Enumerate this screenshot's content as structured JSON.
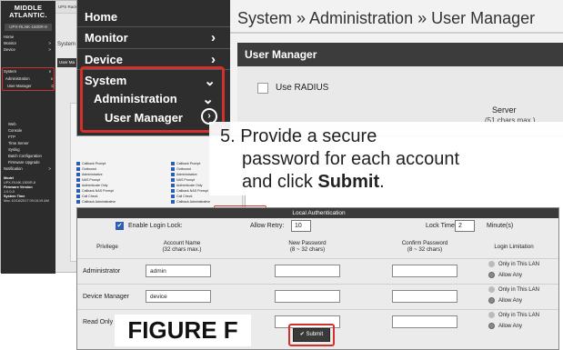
{
  "background": {
    "brand": "MIDDLE ATLANTIC.",
    "header_frag": "UPS RackL...",
    "model": "UPX-RLNK-1500R-8",
    "breadcrumb_frag": "System",
    "tab_frag": "User Ma",
    "nav": [
      {
        "label": "Home",
        "chevron": ""
      },
      {
        "label": "Monitor",
        "chevron": ">"
      },
      {
        "label": "Device",
        "chevron": ">"
      },
      {
        "label": "System",
        "chevron": "v"
      },
      {
        "label": "Administration",
        "chevron": "v"
      },
      {
        "label": "User Manager",
        "chevron": "⊙"
      },
      {
        "label": "Web",
        "chevron": ""
      },
      {
        "label": "Console",
        "chevron": ""
      },
      {
        "label": "FTP",
        "chevron": ""
      },
      {
        "label": "Time Server",
        "chevron": ""
      },
      {
        "label": "Syslog",
        "chevron": ""
      },
      {
        "label": "Batch Configuration",
        "chevron": ""
      },
      {
        "label": "Firmware Upgrade",
        "chevron": ""
      },
      {
        "label": "Notification",
        "chevron": ">"
      }
    ],
    "info": {
      "model_label": "Model",
      "model_value": "UPX-RLNK-1500R-8",
      "fw_label": "Firmware Version",
      "fw_value": "1.0.0-0",
      "time_label": "System Time",
      "time_value": "Mon 10/16/2017 09:16:19 AM"
    },
    "panel_rows_left": [
      "Callback Prompt",
      "Outbound",
      "Administrative",
      "NAS Prompt",
      "Authenticate Only",
      "Callback NAS Prompt",
      "Call Check",
      "Callback Administrative"
    ],
    "panel_rows_right": [
      "Callback Prompt",
      "Outbound",
      "Administrative",
      "NAS Prompt",
      "Authenticate Only",
      "Callback NAS Prompt",
      "Call Check",
      "Callback Administrative"
    ],
    "local_auth_btn": "Local Authentication",
    "enable_login_frag": "Enable Login Lock",
    "allow_frag": "Allow",
    "tbl_head_frag": "Account Name          New Password"
  },
  "zoom_top": {
    "sidebar": {
      "home": "Home",
      "monitor": "Monitor",
      "device": "Device",
      "system": "System",
      "administration": "Administration",
      "user_manager": "User Manager",
      "chev_right": "›",
      "chev_down": "⌄",
      "go_icon": "›"
    },
    "breadcrumb": "System » Administration » User Manager",
    "bar_title": "User Manager",
    "use_radius": "Use RADIUS",
    "server_label": "Server",
    "server_sub": "(51 chars max.)"
  },
  "step": {
    "line1": "5. Provide a secure",
    "line2": "password for each account",
    "line3_pre": "and click ",
    "line3_bold": "Submit",
    "line3_post": "."
  },
  "local_auth": {
    "title": "Local Authentication",
    "enable_login_lock": "Enable Login Lock:",
    "allow_retry_label": "Allow Retry:",
    "allow_retry_value": "10",
    "lock_time_label": "Lock Time:",
    "lock_time_value": "2",
    "minutes_label": "Minute(s)",
    "headers": {
      "privilege": "Privilege",
      "account_name": "Account Name",
      "account_name_sub": "(32 chars max.)",
      "new_password": "New Password",
      "new_password_sub": "(8 ~ 32 chars)",
      "confirm_password": "Confirm Password",
      "confirm_password_sub": "(8 ~ 32 chars)",
      "login_limitation": "Login Limitation"
    },
    "users": [
      {
        "privilege": "Administrator",
        "account": "admin",
        "opt1": "Only in This LAN",
        "opt2": "Allow Any"
      },
      {
        "privilege": "Device Manager",
        "account": "device",
        "opt1": "Only in This LAN",
        "opt2": "Allow Any"
      },
      {
        "privilege": "Read Only User",
        "account": "user",
        "opt1": "Only in This LAN",
        "opt2": "Allow Any"
      }
    ],
    "submit_label": "Submit",
    "checkmark": "✔"
  },
  "figure_label": "FIGURE F",
  "colors": {
    "highlight": "#d32f2f",
    "sidebar": "#2e2e2e",
    "checkbox": "#2c5fb1"
  }
}
